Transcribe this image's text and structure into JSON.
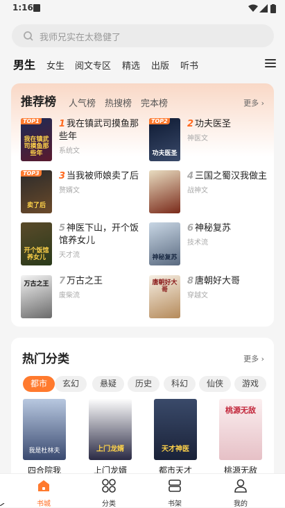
{
  "status_bar": {
    "time": "1:16"
  },
  "search": {
    "placeholder": "我师兄实在太稳健了"
  },
  "top_tabs": [
    {
      "label": "男生"
    },
    {
      "label": "女生"
    },
    {
      "label": "阅文专区"
    },
    {
      "label": "精选"
    },
    {
      "label": "出版"
    },
    {
      "label": "听书"
    }
  ],
  "ranking": {
    "title": "推荐榜",
    "subtabs": [
      "人气榜",
      "热搜榜",
      "完本榜"
    ],
    "more": "更多",
    "books": [
      {
        "rank": "1",
        "badge": "TOP1",
        "title": "我在镇武司摸鱼那些年",
        "genre": "系统文",
        "cover_text": "我在镇武司摸鱼那些年"
      },
      {
        "rank": "2",
        "badge": "TOP2",
        "title": "功夫医圣",
        "genre": "神医文",
        "cover_text": "功夫医圣"
      },
      {
        "rank": "3",
        "badge": "TOP3",
        "title": "当我被师娘卖了后",
        "genre": "赘婿文",
        "cover_text": "卖了后"
      },
      {
        "rank": "4",
        "badge": "",
        "title": "三国之蜀汉我做主",
        "genre": "战神文",
        "cover_text": ""
      },
      {
        "rank": "5",
        "badge": "",
        "title": "神医下山，开个饭馆养女儿",
        "genre": "天才流",
        "cover_text": "开个饭馆养女儿"
      },
      {
        "rank": "6",
        "badge": "",
        "title": "神秘复苏",
        "genre": "技术流",
        "cover_text": "神秘复苏"
      },
      {
        "rank": "7",
        "badge": "",
        "title": "万古之王",
        "genre": "废柴流",
        "cover_text": "万古之王"
      },
      {
        "rank": "8",
        "badge": "",
        "title": "唐朝好大哥",
        "genre": "穿越文",
        "cover_text": "唐朝好大哥"
      }
    ]
  },
  "categories": {
    "title": "热门分类",
    "more": "更多",
    "chips": [
      "都市",
      "玄幻",
      "悬疑",
      "历史",
      "科幻",
      "仙侠",
      "游戏"
    ],
    "books": [
      {
        "title": "四合院我",
        "cover_text": "我是杜林夫"
      },
      {
        "title": "上门龙婿",
        "cover_text": "上门龙婿"
      },
      {
        "title": "都市天才",
        "cover_text": "天才神医"
      },
      {
        "title": "桃源无敌",
        "cover_text": "桃源无敌"
      }
    ]
  },
  "bottom_nav": [
    {
      "label": "书城",
      "icon": "home-icon"
    },
    {
      "label": "分类",
      "icon": "category-icon"
    },
    {
      "label": "书架",
      "icon": "bookshelf-icon"
    },
    {
      "label": "我的",
      "icon": "profile-icon"
    }
  ],
  "colors": {
    "accent": "#ff7a2e",
    "rank_hot": "#ff6a1f"
  }
}
